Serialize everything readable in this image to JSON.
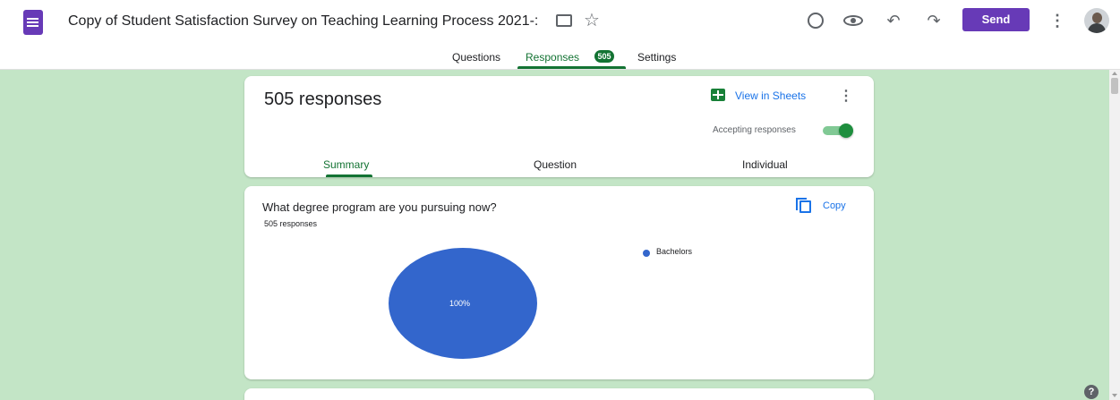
{
  "header": {
    "document_title": "Copy of Student Satisfaction Survey on Teaching Learning Process 2021-:",
    "send_label": "Send",
    "icons": [
      "forms-app-icon",
      "folder-icon",
      "star-icon",
      "palette-icon",
      "eye-icon",
      "undo-icon",
      "redo-icon",
      "more-vert-icon",
      "avatar"
    ]
  },
  "tabs": [
    {
      "label": "Questions"
    },
    {
      "label": "Responses",
      "badge": "505",
      "selected": true
    },
    {
      "label": "Settings"
    }
  ],
  "summary_card": {
    "responses_title": "505 responses",
    "view_sheets_label": "View in Sheets",
    "accepting_label": "Accepting responses",
    "accepting_on": true,
    "subtabs": [
      {
        "label": "Summary",
        "selected": true
      },
      {
        "label": "Question"
      },
      {
        "label": "Individual"
      }
    ]
  },
  "question_card": {
    "title": "What degree program are you pursuing now?",
    "response_count": "505 responses",
    "copy_label": "Copy"
  },
  "chart_data": {
    "type": "pie",
    "categories": [
      "Bachelors"
    ],
    "values": [
      100
    ],
    "slice_labels": [
      "100%"
    ],
    "colors": [
      "#3366cc"
    ],
    "legend_position": "right"
  },
  "colors": {
    "brand": "#673ab7",
    "background": "#c3e5c6",
    "accent_green": "#137333",
    "link_blue": "#1a73e8"
  }
}
